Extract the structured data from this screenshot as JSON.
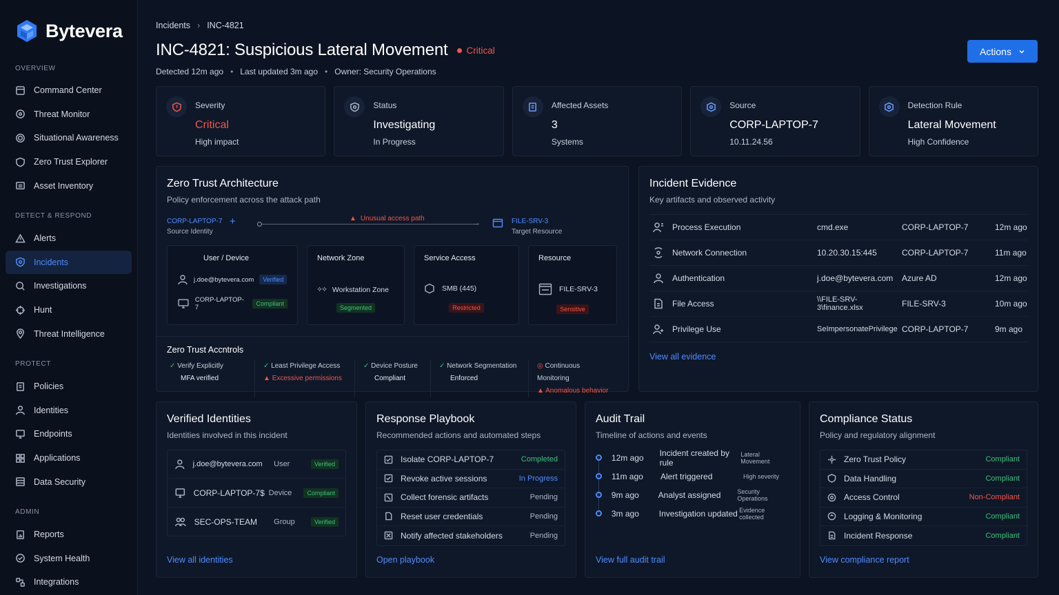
{
  "brand": {
    "name": "Bytevera"
  },
  "nav": {
    "overview": {
      "label": "OVERVIEW",
      "items": [
        "Command Center",
        "Threat Monitor",
        "Situational Awareness",
        "Zero Trust Explorer",
        "Asset Inventory"
      ]
    },
    "detect": {
      "label": "DETECT & RESPOND",
      "items": [
        "Alerts",
        "Incidents",
        "Investigations",
        "Hunt",
        "Threat Intelligence"
      ]
    },
    "protect": {
      "label": "PROTECT",
      "items": [
        "Policies",
        "Identities",
        "Endpoints",
        "Applications",
        "Data Security"
      ]
    },
    "admin": {
      "label": "ADMIN",
      "items": [
        "Reports",
        "System Health",
        "Integrations"
      ]
    }
  },
  "breadcrumb": {
    "parent": "Incidents",
    "current": "INC-4821"
  },
  "header": {
    "title": "INC-4821: Suspicious Lateral Movement",
    "severity": "Critical",
    "actions": "Actions",
    "detected": "Detected 12m ago",
    "updated": "Last updated 3m ago",
    "owner": "Owner: Security Operations"
  },
  "stats": [
    {
      "label": "Severity",
      "value": "Critical",
      "sub": "High impact"
    },
    {
      "label": "Status",
      "value": "Investigating",
      "sub": "In Progress"
    },
    {
      "label": "Affected Assets",
      "value": "3",
      "sub": "Systems"
    },
    {
      "label": "Source",
      "value": "CORP-LAPTOP-7",
      "sub": "10.11.24.56"
    },
    {
      "label": "Detection Rule",
      "value": "Lateral Movement",
      "sub": "High Confidence"
    }
  ],
  "zt": {
    "title": "Zero Trust Architecture",
    "subtitle": "Policy enforcement across the attack path",
    "source": "CORP-LAPTOP-7",
    "source_label": "Source Identity",
    "alert": "Unusual access path",
    "target": "FILE-SRV-3",
    "target_label": "Target Resource",
    "boxes": {
      "user": "User / Device",
      "user_email": "j.doe@bytevera.com",
      "verified": "Verified",
      "device": "CORP-LAPTOP-7",
      "compliant": "Compliant",
      "net": "Network Zone",
      "net_val": "Workstation Zone",
      "net_tag": "Segmented",
      "svc": "Service Access",
      "svc_val": "SMB (445)",
      "svc_tag": "Restricted",
      "res": "Resource",
      "res_val": "FILE-SRV-3",
      "res_tag": "Sensitive"
    },
    "controls_title": "Zero Trust Accntrols",
    "controls": [
      {
        "name": "Verify Explicitly",
        "sub": "MFA verified"
      },
      {
        "name": "Least Privilege Access",
        "sub": "Excessive permissions"
      },
      {
        "name": "Device Posture",
        "sub": "Compliant"
      },
      {
        "name": "Network Segmentation",
        "sub": "Enforced"
      },
      {
        "name": "Continuous Monitoring",
        "sub": "Anomalous behavior"
      }
    ]
  },
  "evidence": {
    "title": "Incident Evidence",
    "subtitle": "Key artifacts and observed activity",
    "link": "View all evidence",
    "rows": [
      {
        "type": "Process Execution",
        "detail": "cmd.exe",
        "host": "CORP-LAPTOP-7",
        "time": "12m ago"
      },
      {
        "type": "Network Connection",
        "detail": "10.20.30.15:445",
        "host": "CORP-LAPTOP-7",
        "time": "11m ago"
      },
      {
        "type": "Authentication",
        "detail": "j.doe@bytevera.com",
        "host": "Azure AD",
        "time": "12m ago"
      },
      {
        "type": "File Access",
        "detail": "\\\\FILE-SRV-3\\finance.xlsx",
        "host": "FILE-SRV-3",
        "time": "10m ago"
      },
      {
        "type": "Privilege Use",
        "detail": "SeImpersonatePrivilege",
        "host": "CORP-LAPTOP-7",
        "time": "9m ago"
      }
    ]
  },
  "identities": {
    "title": "Verified Identities",
    "subtitle": "Identities involved in this incident",
    "link": "View all identities",
    "rows": [
      {
        "name": "j.doe@bytevera.com",
        "type": "User",
        "status": "Verified"
      },
      {
        "name": "CORP-LAPTOP-7$",
        "type": "Device",
        "status": "Compliant"
      },
      {
        "name": "SEC-OPS-TEAM",
        "type": "Group",
        "status": "Verified"
      }
    ]
  },
  "playbook": {
    "title": "Response Playbook",
    "subtitle": "Recommended actions and automated steps",
    "link": "Open playbook",
    "rows": [
      {
        "step": "Isolate CORP-LAPTOP-7",
        "status": "Completed"
      },
      {
        "step": "Revoke active sessions",
        "status": "In Progress"
      },
      {
        "step": "Collect forensic artifacts",
        "status": "Pending"
      },
      {
        "step": "Reset user credentials",
        "status": "Pending"
      },
      {
        "step": "Notify affected stakeholders",
        "status": "Pending"
      }
    ]
  },
  "audit": {
    "title": "Audit Trail",
    "subtitle": "Timeline of actions and events",
    "link": "View full audit trail",
    "rows": [
      {
        "time": "12m ago",
        "event": "Incident created by rule",
        "detail": "Lateral Movement"
      },
      {
        "time": "11m ago",
        "event": "Alert triggered",
        "detail": "High severity"
      },
      {
        "time": "9m ago",
        "event": "Analyst assigned",
        "detail": "Security Operations"
      },
      {
        "time": "3m ago",
        "event": "Investigation updated",
        "detail": "Evidence collected"
      }
    ]
  },
  "compliance": {
    "title": "Compliance Status",
    "subtitle": "Policy and regulatory alignment",
    "link": "View compliance report",
    "rows": [
      {
        "name": "Zero Trust Policy",
        "status": "Compliant"
      },
      {
        "name": "Data Handling",
        "status": "Compliant"
      },
      {
        "name": "Access Control",
        "status": "Non-Compliant"
      },
      {
        "name": "Logging & Monitoring",
        "status": "Compliant"
      },
      {
        "name": "Incident Response",
        "status": "Compliant"
      }
    ]
  },
  "colors": {
    "accent": "#4f8cff",
    "critical": "#f0564a",
    "ok": "#3ec07a"
  }
}
